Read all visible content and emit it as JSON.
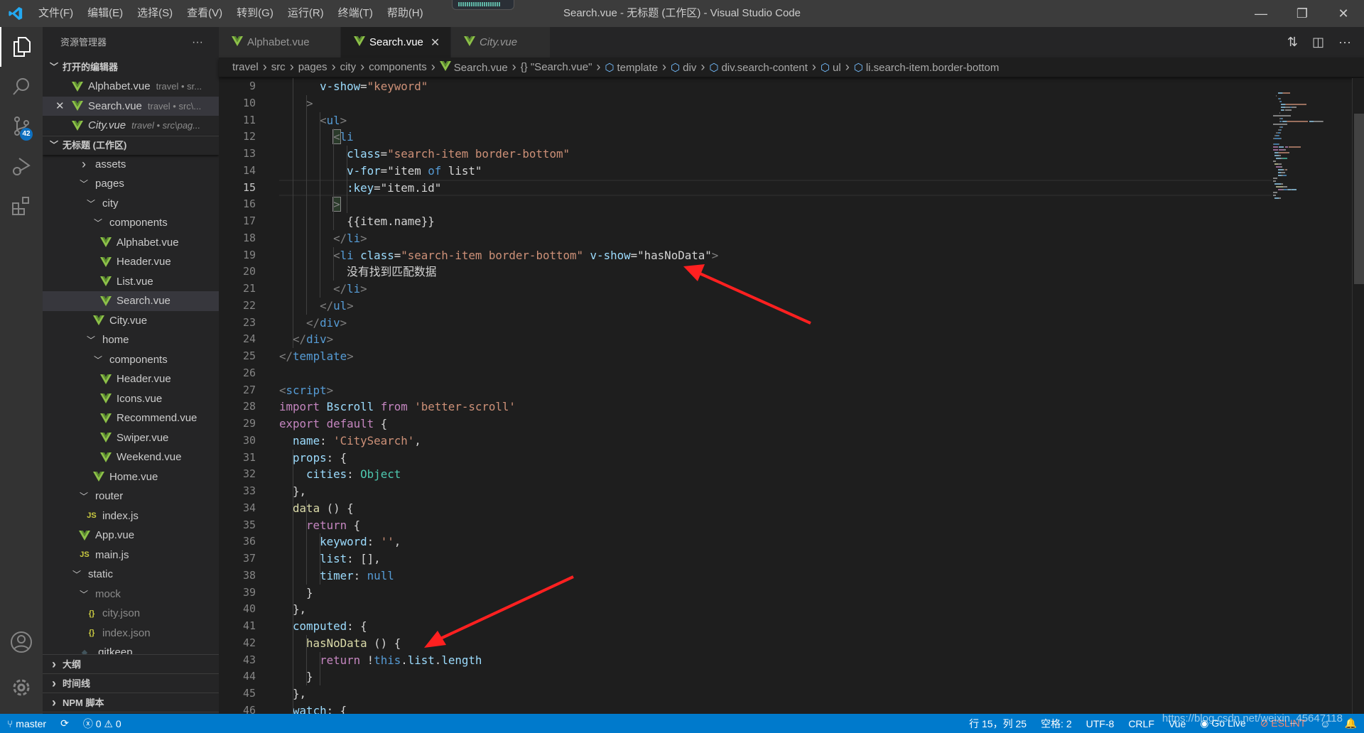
{
  "window": {
    "title": "Search.vue - 无标题 (工作区) - Visual Studio Code",
    "menu": [
      "文件(F)",
      "编辑(E)",
      "选择(S)",
      "查看(V)",
      "转到(G)",
      "运行(R)",
      "终端(T)",
      "帮助(H)"
    ]
  },
  "activity": {
    "scm_badge": "42"
  },
  "sidebar": {
    "title": "资源管理器",
    "more": "···",
    "open_editors_label": "打开的编辑器",
    "open_editors": [
      {
        "label": "Alphabet.vue",
        "desc": "travel • sr...",
        "italic": false,
        "close": false
      },
      {
        "label": "Search.vue",
        "desc": "travel • src\\...",
        "italic": false,
        "close": true
      },
      {
        "label": "City.vue",
        "desc": "travel • src\\pag...",
        "italic": true,
        "close": false
      }
    ],
    "workspace_label": "无标题 (工作区)",
    "tree": [
      {
        "label": "assets",
        "depth": 1,
        "type": "folder-closed"
      },
      {
        "label": "pages",
        "depth": 1,
        "type": "folder-open"
      },
      {
        "label": "city",
        "depth": 2,
        "type": "folder-open"
      },
      {
        "label": "components",
        "depth": 3,
        "type": "folder-open"
      },
      {
        "label": "Alphabet.vue",
        "depth": 4,
        "type": "vue"
      },
      {
        "label": "Header.vue",
        "depth": 4,
        "type": "vue"
      },
      {
        "label": "List.vue",
        "depth": 4,
        "type": "vue"
      },
      {
        "label": "Search.vue",
        "depth": 4,
        "type": "vue",
        "selected": true
      },
      {
        "label": "City.vue",
        "depth": 3,
        "type": "vue"
      },
      {
        "label": "home",
        "depth": 2,
        "type": "folder-open"
      },
      {
        "label": "components",
        "depth": 3,
        "type": "folder-open"
      },
      {
        "label": "Header.vue",
        "depth": 4,
        "type": "vue"
      },
      {
        "label": "Icons.vue",
        "depth": 4,
        "type": "vue"
      },
      {
        "label": "Recommend.vue",
        "depth": 4,
        "type": "vue"
      },
      {
        "label": "Swiper.vue",
        "depth": 4,
        "type": "vue"
      },
      {
        "label": "Weekend.vue",
        "depth": 4,
        "type": "vue"
      },
      {
        "label": "Home.vue",
        "depth": 3,
        "type": "vue"
      },
      {
        "label": "router",
        "depth": 1,
        "type": "folder-open"
      },
      {
        "label": "index.js",
        "depth": 2,
        "type": "js"
      },
      {
        "label": "App.vue",
        "depth": 1,
        "type": "vue"
      },
      {
        "label": "main.js",
        "depth": 1,
        "type": "js"
      },
      {
        "label": "static",
        "depth": 0,
        "type": "folder-open"
      },
      {
        "label": "mock",
        "depth": 1,
        "type": "folder-open",
        "muted": true
      },
      {
        "label": "city.json",
        "depth": 2,
        "type": "json",
        "muted": true
      },
      {
        "label": "index.json",
        "depth": 2,
        "type": "json",
        "muted": true
      },
      {
        "label": ".gitkeep",
        "depth": 1,
        "type": "gitkeep"
      }
    ],
    "bottom_sections": [
      "大纲",
      "时间线",
      "NPM 脚本"
    ]
  },
  "tabs": [
    {
      "label": "Alphabet.vue",
      "active": false,
      "italic": false
    },
    {
      "label": "Search.vue",
      "active": true,
      "italic": false,
      "close": "✕"
    },
    {
      "label": "City.vue",
      "active": false,
      "italic": true
    }
  ],
  "breadcrumb": [
    {
      "label": "travel"
    },
    {
      "label": "src"
    },
    {
      "label": "pages"
    },
    {
      "label": "city"
    },
    {
      "label": "components"
    },
    {
      "label": "Search.vue",
      "icon": "vue"
    },
    {
      "label": "\"Search.vue\"",
      "icon": "braces"
    },
    {
      "label": "template",
      "icon": "cube"
    },
    {
      "label": "div",
      "icon": "cube"
    },
    {
      "label": "div.search-content",
      "icon": "cube"
    },
    {
      "label": "ul",
      "icon": "cube"
    },
    {
      "label": "li.search-item.border-bottom",
      "icon": "cube"
    }
  ],
  "editor": {
    "current_line": 15,
    "lines": [
      {
        "n": 9,
        "t": [
          [
            "d",
            "      "
          ],
          [
            "a",
            "v-show"
          ],
          [
            "d",
            "="
          ],
          [
            "s",
            "\"keyword\""
          ]
        ]
      },
      {
        "n": 10,
        "t": [
          [
            "d",
            "    "
          ],
          [
            "p",
            ">"
          ]
        ]
      },
      {
        "n": 11,
        "t": [
          [
            "d",
            "      "
          ],
          [
            "p",
            "<"
          ],
          [
            "n",
            "ul"
          ],
          [
            "p",
            ">"
          ]
        ]
      },
      {
        "n": 12,
        "t": [
          [
            "d",
            "        "
          ],
          [
            "p",
            "<"
          ],
          [
            "n",
            "li"
          ]
        ]
      },
      {
        "n": 13,
        "t": [
          [
            "d",
            "          "
          ],
          [
            "a",
            "class"
          ],
          [
            "d",
            "="
          ],
          [
            "s",
            "\"search-item border-bottom\""
          ]
        ]
      },
      {
        "n": 14,
        "t": [
          [
            "d",
            "          "
          ],
          [
            "a",
            "v-for"
          ],
          [
            "d",
            "="
          ],
          [
            "d",
            "\"item "
          ],
          [
            "c",
            "of"
          ],
          [
            "d",
            " list\""
          ]
        ]
      },
      {
        "n": 15,
        "t": [
          [
            "d",
            "          "
          ],
          [
            "a",
            ":key"
          ],
          [
            "d",
            "="
          ],
          [
            "d",
            "\"item.id\""
          ]
        ]
      },
      {
        "n": 16,
        "t": [
          [
            "d",
            "        "
          ],
          [
            "p",
            ">"
          ]
        ]
      },
      {
        "n": 17,
        "t": [
          [
            "d",
            "          {{item.name}}"
          ]
        ]
      },
      {
        "n": 18,
        "t": [
          [
            "d",
            "        "
          ],
          [
            "p",
            "</"
          ],
          [
            "n",
            "li"
          ],
          [
            "p",
            ">"
          ]
        ]
      },
      {
        "n": 19,
        "t": [
          [
            "d",
            "        "
          ],
          [
            "p",
            "<"
          ],
          [
            "n",
            "li"
          ],
          [
            "d",
            " "
          ],
          [
            "a",
            "class"
          ],
          [
            "d",
            "="
          ],
          [
            "s",
            "\"search-item border-bottom\""
          ],
          [
            "d",
            " "
          ],
          [
            "a",
            "v-show"
          ],
          [
            "d",
            "="
          ],
          [
            "d",
            "\"hasNoData\""
          ],
          [
            "p",
            ">"
          ]
        ]
      },
      {
        "n": 20,
        "t": [
          [
            "d",
            "          没有找到匹配数据"
          ]
        ]
      },
      {
        "n": 21,
        "t": [
          [
            "d",
            "        "
          ],
          [
            "p",
            "</"
          ],
          [
            "n",
            "li"
          ],
          [
            "p",
            ">"
          ]
        ]
      },
      {
        "n": 22,
        "t": [
          [
            "d",
            "      "
          ],
          [
            "p",
            "</"
          ],
          [
            "n",
            "ul"
          ],
          [
            "p",
            ">"
          ]
        ]
      },
      {
        "n": 23,
        "t": [
          [
            "d",
            "    "
          ],
          [
            "p",
            "</"
          ],
          [
            "n",
            "div"
          ],
          [
            "p",
            ">"
          ]
        ]
      },
      {
        "n": 24,
        "t": [
          [
            "d",
            "  "
          ],
          [
            "p",
            "</"
          ],
          [
            "n",
            "div"
          ],
          [
            "p",
            ">"
          ]
        ]
      },
      {
        "n": 25,
        "t": [
          [
            "p",
            "</"
          ],
          [
            "n",
            "template"
          ],
          [
            "p",
            ">"
          ]
        ]
      },
      {
        "n": 26,
        "t": []
      },
      {
        "n": 27,
        "t": [
          [
            "p",
            "<"
          ],
          [
            "n",
            "script"
          ],
          [
            "p",
            ">"
          ]
        ]
      },
      {
        "n": 28,
        "t": [
          [
            "k",
            "import"
          ],
          [
            "d",
            " "
          ],
          [
            "a",
            "Bscroll"
          ],
          [
            "d",
            " "
          ],
          [
            "k",
            "from"
          ],
          [
            "d",
            " "
          ],
          [
            "s",
            "'better-scroll'"
          ]
        ]
      },
      {
        "n": 29,
        "t": [
          [
            "k",
            "export"
          ],
          [
            "d",
            " "
          ],
          [
            "k",
            "default"
          ],
          [
            "d",
            " {"
          ]
        ]
      },
      {
        "n": 30,
        "t": [
          [
            "d",
            "  "
          ],
          [
            "a",
            "name"
          ],
          [
            "d",
            ": "
          ],
          [
            "s",
            "'CitySearch'"
          ],
          [
            "d",
            ","
          ]
        ]
      },
      {
        "n": 31,
        "t": [
          [
            "d",
            "  "
          ],
          [
            "a",
            "props"
          ],
          [
            "d",
            ": {"
          ]
        ]
      },
      {
        "n": 32,
        "t": [
          [
            "d",
            "    "
          ],
          [
            "a",
            "cities"
          ],
          [
            "d",
            ": "
          ],
          [
            "y",
            "Object"
          ]
        ]
      },
      {
        "n": 33,
        "t": [
          [
            "d",
            "  },"
          ]
        ]
      },
      {
        "n": 34,
        "t": [
          [
            "d",
            "  "
          ],
          [
            "f",
            "data"
          ],
          [
            "d",
            " () {"
          ]
        ]
      },
      {
        "n": 35,
        "t": [
          [
            "d",
            "    "
          ],
          [
            "k",
            "return"
          ],
          [
            "d",
            " {"
          ]
        ]
      },
      {
        "n": 36,
        "t": [
          [
            "d",
            "      "
          ],
          [
            "a",
            "keyword"
          ],
          [
            "d",
            ": "
          ],
          [
            "s",
            "''"
          ],
          [
            "d",
            ","
          ]
        ]
      },
      {
        "n": 37,
        "t": [
          [
            "d",
            "      "
          ],
          [
            "a",
            "list"
          ],
          [
            "d",
            ": [],"
          ]
        ]
      },
      {
        "n": 38,
        "t": [
          [
            "d",
            "      "
          ],
          [
            "a",
            "timer"
          ],
          [
            "d",
            ": "
          ],
          [
            "c",
            "null"
          ]
        ]
      },
      {
        "n": 39,
        "t": [
          [
            "d",
            "    }"
          ]
        ]
      },
      {
        "n": 40,
        "t": [
          [
            "d",
            "  },"
          ]
        ]
      },
      {
        "n": 41,
        "t": [
          [
            "d",
            "  "
          ],
          [
            "a",
            "computed"
          ],
          [
            "d",
            ": {"
          ]
        ]
      },
      {
        "n": 42,
        "t": [
          [
            "d",
            "    "
          ],
          [
            "f",
            "hasNoData"
          ],
          [
            "d",
            " () {"
          ]
        ]
      },
      {
        "n": 43,
        "t": [
          [
            "d",
            "      "
          ],
          [
            "k",
            "return"
          ],
          [
            "d",
            " !"
          ],
          [
            "c",
            "this"
          ],
          [
            "d",
            "."
          ],
          [
            "a",
            "list"
          ],
          [
            "d",
            "."
          ],
          [
            "a",
            "length"
          ]
        ]
      },
      {
        "n": 44,
        "t": [
          [
            "d",
            "    }"
          ]
        ]
      },
      {
        "n": 45,
        "t": [
          [
            "d",
            "  },"
          ]
        ]
      },
      {
        "n": 46,
        "t": [
          [
            "d",
            "  "
          ],
          [
            "a",
            "watch"
          ],
          [
            "d",
            ": {"
          ]
        ]
      }
    ]
  },
  "statusbar": {
    "branch": "master",
    "errors": "0",
    "warnings": "0",
    "position": "行 15，列 25",
    "spaces": "空格: 2",
    "encoding": "UTF-8",
    "eol": "CRLF",
    "language": "Vue",
    "golive": "Go Live",
    "eslint": "ESLINT",
    "watermark": "https://blog.csdn.net/weixin_45647118"
  },
  "colors": {
    "accent": "#007acc",
    "vue": "#41b883",
    "arrow": "#ff2020"
  }
}
